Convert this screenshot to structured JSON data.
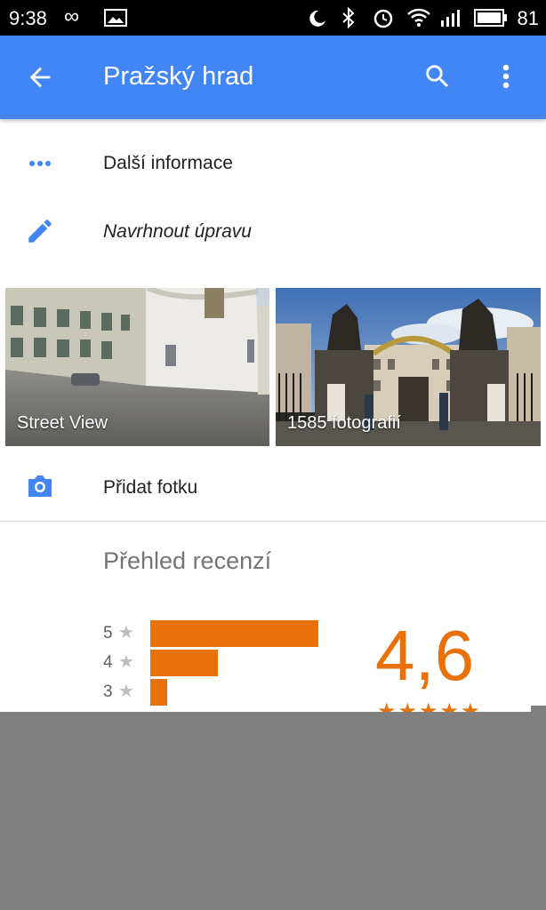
{
  "status_bar": {
    "time": "9:38",
    "battery": "81",
    "icons": [
      "infinity-icon",
      "image-icon",
      "night-mode-icon",
      "bluetooth-icon",
      "alarm-icon",
      "wifi-icon",
      "signal-icon",
      "battery-icon"
    ]
  },
  "app_bar": {
    "title": "Pražský hrad",
    "color": "#4285f4"
  },
  "actions": {
    "more_info": "Další informace",
    "suggest_edit": "Navrhnout úpravu",
    "add_photo": "Přidat fotku"
  },
  "photos": {
    "street_view": "Street View",
    "photos_count": "1585 fotografií"
  },
  "reviews": {
    "title": "Přehled recenzí",
    "rating": "4,6",
    "accent_color": "#e8710a",
    "histogram": [
      {
        "stars": "5",
        "share": 1.0
      },
      {
        "stars": "4",
        "share": 0.4
      },
      {
        "stars": "3",
        "share": 0.1
      }
    ]
  }
}
